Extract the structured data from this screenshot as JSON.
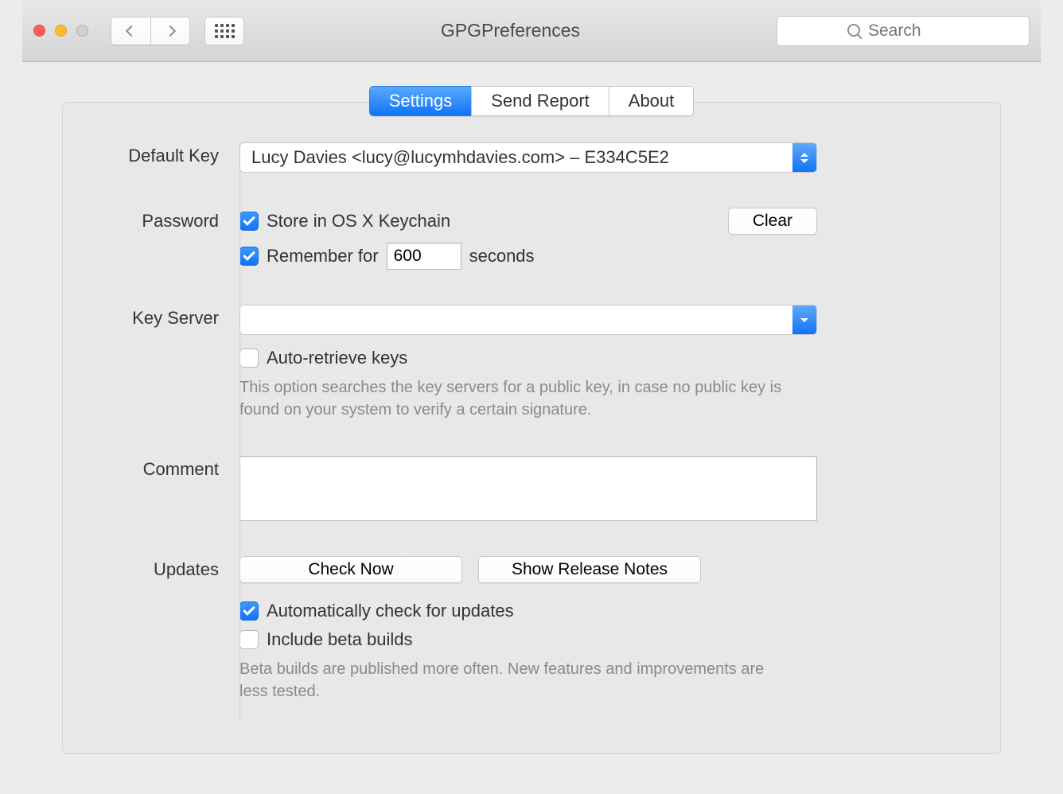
{
  "window": {
    "title": "GPGPreferences",
    "search_placeholder": "Search"
  },
  "tabs": {
    "settings": "Settings",
    "send_report": "Send Report",
    "about": "About"
  },
  "labels": {
    "default_key": "Default Key",
    "password": "Password",
    "key_server": "Key Server",
    "comment": "Comment",
    "updates": "Updates"
  },
  "default_key": {
    "selected": "Lucy Davies <lucy@lucymhdavies.com> – E334C5E2"
  },
  "password": {
    "store_keychain": "Store in OS X Keychain",
    "remember_for": "Remember for",
    "remember_seconds_value": "600",
    "seconds_label": "seconds",
    "clear_button": "Clear"
  },
  "keyserver": {
    "selected": "",
    "auto_retrieve": "Auto-retrieve keys",
    "help": "This option searches the key servers for a public key, in case no public key is found on your system to verify a certain signature."
  },
  "comment": {
    "value": ""
  },
  "updates": {
    "check_now": "Check Now",
    "release_notes": "Show Release Notes",
    "auto_check": "Automatically check for updates",
    "include_beta": "Include beta builds",
    "beta_help": "Beta builds are published more often. New features and improvements are less tested."
  }
}
